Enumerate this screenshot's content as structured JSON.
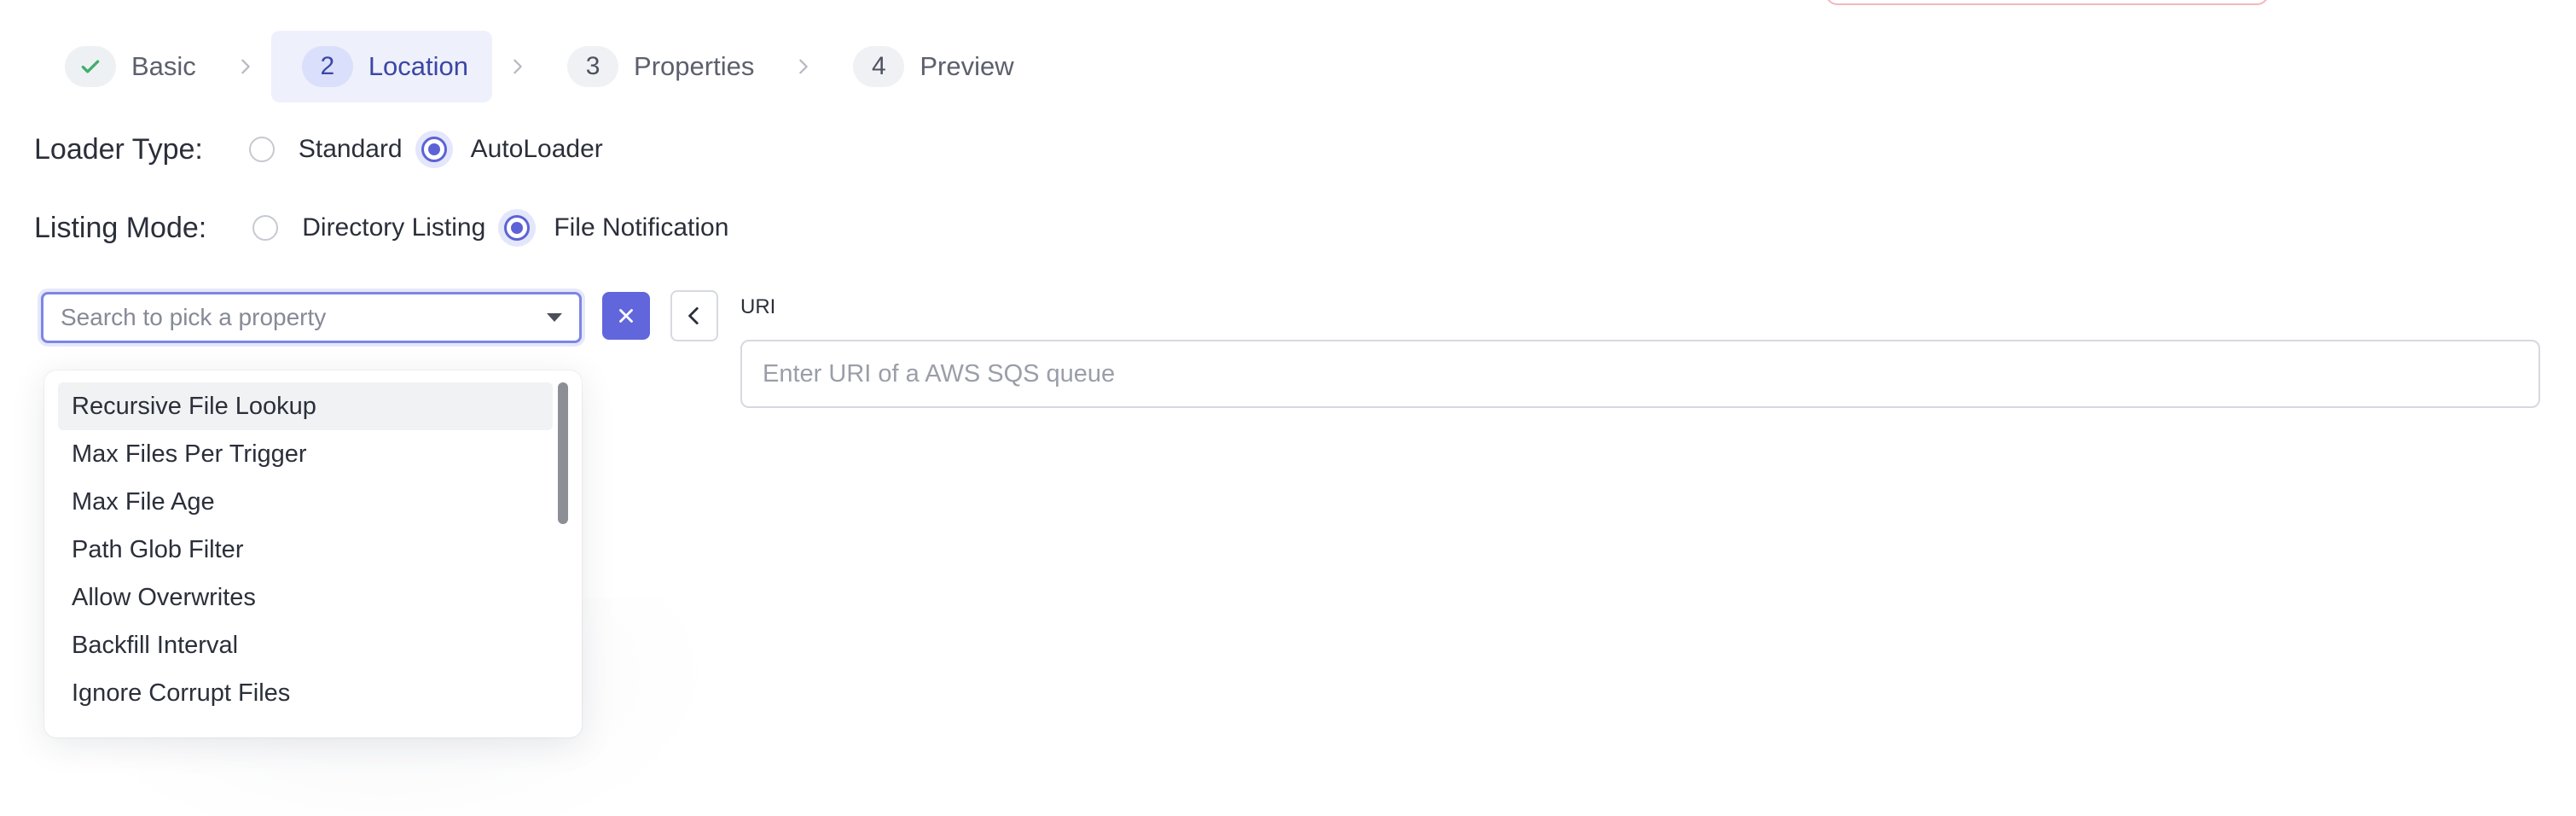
{
  "stepper": {
    "steps": [
      {
        "badge": "",
        "label": "Basic",
        "state": "done"
      },
      {
        "badge": "2",
        "label": "Location",
        "state": "active"
      },
      {
        "badge": "3",
        "label": "Properties",
        "state": "pending"
      },
      {
        "badge": "4",
        "label": "Preview",
        "state": "pending"
      }
    ]
  },
  "loader_type": {
    "label": "Loader Type:",
    "options": [
      "Standard",
      "AutoLoader"
    ],
    "selected": "AutoLoader"
  },
  "listing_mode": {
    "label": "Listing Mode:",
    "options": [
      "Directory Listing",
      "File Notification"
    ],
    "selected": "File Notification"
  },
  "property_picker": {
    "placeholder": "Search to pick a property",
    "value": "",
    "options": [
      "Recursive File Lookup",
      "Max Files Per Trigger",
      "Max File Age",
      "Path Glob Filter",
      "Allow Overwrites",
      "Backfill Interval",
      "Ignore Corrupt Files"
    ],
    "highlighted": "Recursive File Lookup",
    "scroll_position": 0
  },
  "uri_field": {
    "label": "URI",
    "placeholder": "Enter URI of a AWS SQS queue",
    "value": ""
  },
  "colors": {
    "accent": "#6166dc",
    "active_step_bg": "#eef0fc",
    "success_check": "#3fae6a"
  },
  "icons": {
    "step_done": "check-icon",
    "step_separator": "chevron-right-icon",
    "select_caret": "caret-down-icon",
    "clear": "close-icon",
    "back": "chevron-left-icon"
  }
}
